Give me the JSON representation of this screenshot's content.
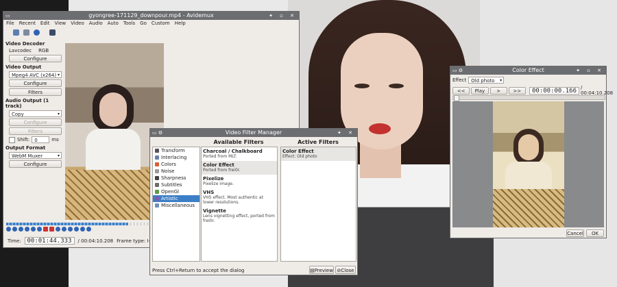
{
  "avidemux": {
    "title": "gyongree-171129_downpour.mp4 - Avidemux",
    "menu": [
      "File",
      "Recent",
      "Edit",
      "View",
      "Video",
      "Audio",
      "Auto",
      "Tools",
      "Go",
      "Custom",
      "Help"
    ],
    "video_decoder": {
      "heading": "Video Decoder",
      "codec": "Lavcodec",
      "format": "RGB",
      "configure": "Configure"
    },
    "video_output": {
      "heading": "Video Output",
      "value": "Mpeg4 AVC (x264)",
      "configure": "Configure",
      "filters": "Filters"
    },
    "audio_output": {
      "heading": "Audio Output (1 track)",
      "value": "Copy",
      "configure": "Configure",
      "filters": "Filters",
      "shift_label": "Shift:",
      "shift_value": "0",
      "shift_unit": "ms"
    },
    "output_format": {
      "heading": "Output Format",
      "value": "WebM Muxer",
      "configure": "Configure"
    },
    "time_label": "Time:",
    "time_value": "00:01:44.333",
    "duration": "/ 00:04:10.208",
    "frame_type": "Frame type: I-FRM (00)",
    "progress": 0.42
  },
  "filter_manager": {
    "title": "Video Filter Manager",
    "categories": [
      "Transform",
      "Interlacing",
      "Colors",
      "Noise",
      "Sharpness",
      "Subtitles",
      "OpenGl",
      "Artistic",
      "Miscellaneous"
    ],
    "selected_category": "Artistic",
    "available_heading": "Available Filters",
    "active_heading": "Active Filters",
    "available": [
      {
        "name": "Charcoal / Chalkboard",
        "desc": "Ported from MLT."
      },
      {
        "name": "Color Effect",
        "desc": "Ported from frei0r."
      },
      {
        "name": "Pixelize",
        "desc": "Pixelize image."
      },
      {
        "name": "VHS",
        "desc": "VHS effect. Most authentic at lower resolutions."
      },
      {
        "name": "Vignette",
        "desc": "Lens vignetting effect, ported from frei0r."
      }
    ],
    "active": [
      {
        "name": "Color Effect",
        "desc": "Effect: Old photo"
      }
    ],
    "hint": "Press Ctrl+Return to accept the dialog",
    "preview": "Preview",
    "close": "Close"
  },
  "color_effect": {
    "title": "Color Effect",
    "effect_label": "Effect",
    "effect_value": "Old photo",
    "nav": [
      "<<",
      "Play",
      ">",
      ">>"
    ],
    "time_value": "00:00:00.166",
    "duration": "/ 00:04:10.208",
    "cancel": "Cancel",
    "ok": "OK"
  },
  "colors": {
    "titlebar": "#6c6d70",
    "selection": "#3d7fc6",
    "window": "#efebe7"
  }
}
